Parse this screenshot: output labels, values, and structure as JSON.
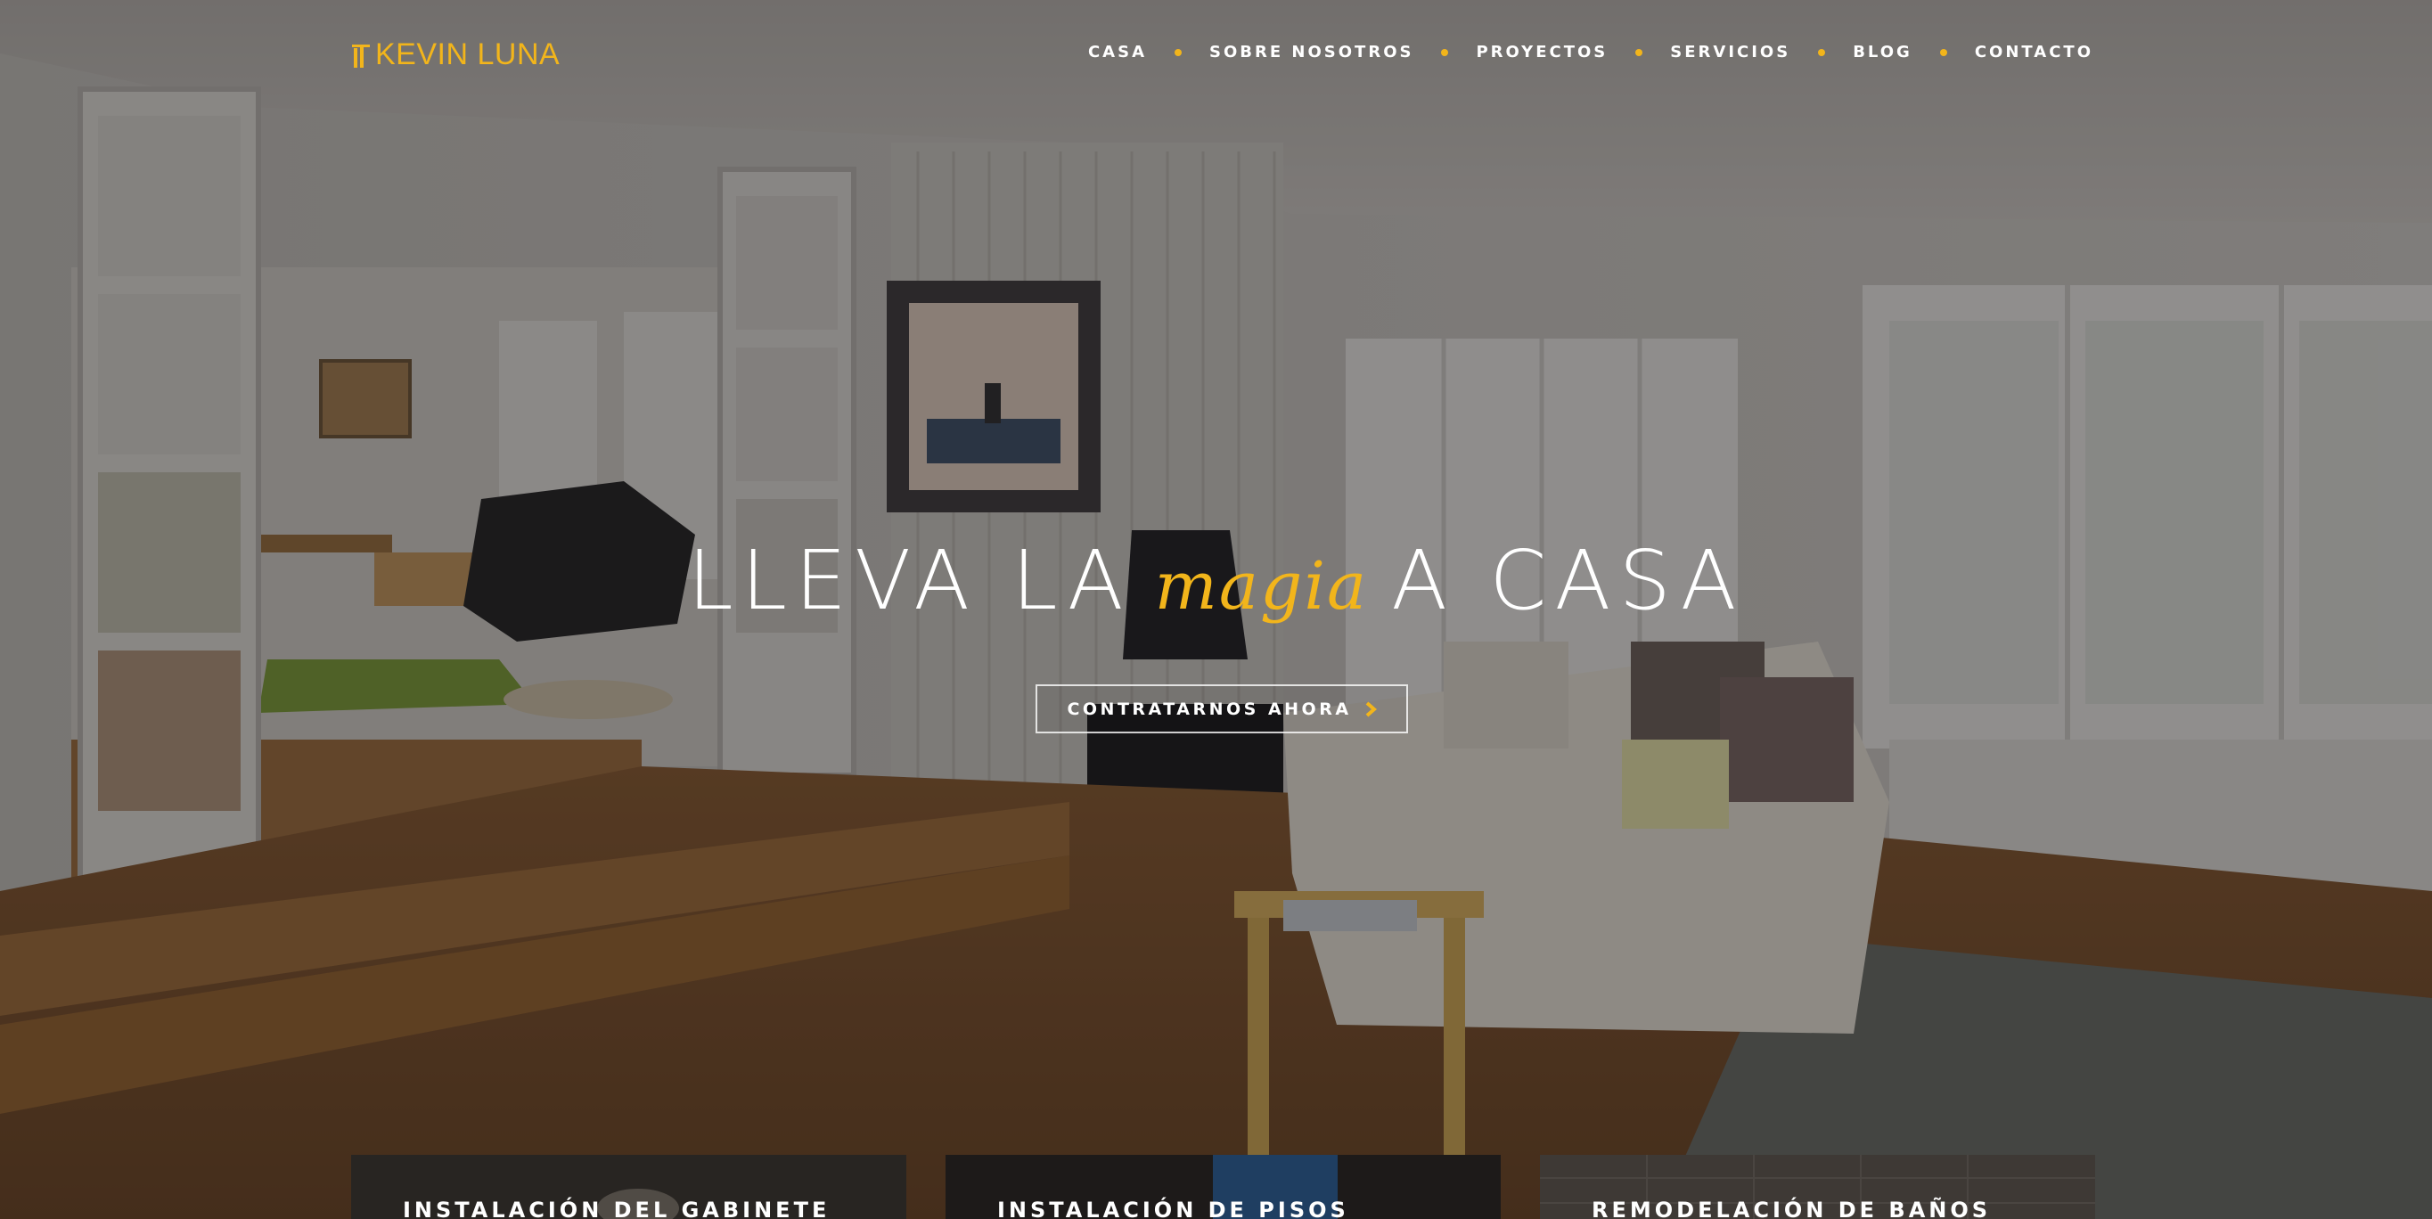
{
  "brand": {
    "name": "KEVIN LUNA",
    "accent_color": "#f2b51b"
  },
  "nav": {
    "items": [
      {
        "label": "CASA"
      },
      {
        "label": "SOBRE NOSOTROS"
      },
      {
        "label": "PROYECTOS"
      },
      {
        "label": "SERVICIOS"
      },
      {
        "label": "BLOG"
      },
      {
        "label": "CONTACTO"
      }
    ],
    "separator_icon": "dot-icon"
  },
  "hero": {
    "headline_before": "LLEVA LA",
    "headline_accent": "magia",
    "headline_after": "A CASA",
    "cta_label": "CONTRATARNOS AHORA",
    "cta_icon": "chevron-right-icon"
  },
  "services": [
    {
      "title": "INSTALACIÓN DEL GABINETE"
    },
    {
      "title": "INSTALACIÓN DE PISOS"
    },
    {
      "title": "REMODELACIÓN DE BAÑOS"
    }
  ]
}
